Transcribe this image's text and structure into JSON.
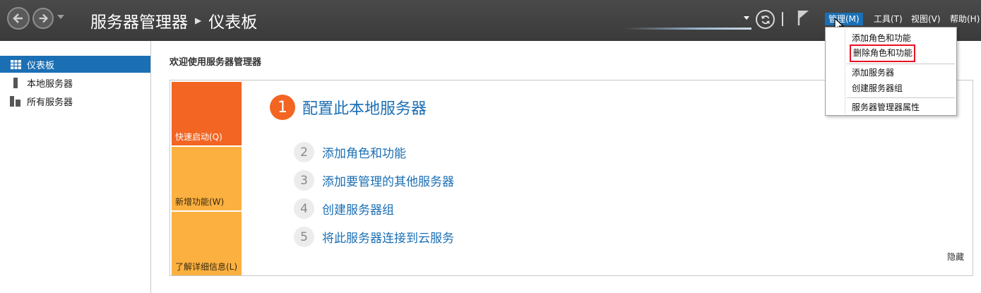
{
  "header": {
    "breadcrumb_root": "服务器管理器",
    "breadcrumb_current": "仪表板",
    "menus": [
      {
        "label": "管理(M)",
        "active": true
      },
      {
        "label": "工具(T)",
        "active": false
      },
      {
        "label": "视图(V)",
        "active": false
      },
      {
        "label": "帮助(H)",
        "active": false
      }
    ]
  },
  "sidebar": {
    "items": [
      {
        "label": "仪表板",
        "icon": "dashboard-icon",
        "selected": true
      },
      {
        "label": "本地服务器",
        "icon": "server-icon",
        "selected": false
      },
      {
        "label": "所有服务器",
        "icon": "servers-icon",
        "selected": false
      }
    ]
  },
  "main": {
    "welcome": "欢迎使用服务器管理器",
    "tiles": [
      "快速启动(Q)",
      "新增功能(W)",
      "了解详细信息(L)"
    ],
    "steps": [
      {
        "num": "1",
        "label": "配置此本地服务器"
      },
      {
        "num": "2",
        "label": "添加角色和功能"
      },
      {
        "num": "3",
        "label": "添加要管理的其他服务器"
      },
      {
        "num": "4",
        "label": "创建服务器组"
      },
      {
        "num": "5",
        "label": "将此服务器连接到云服务"
      }
    ],
    "hide": "隐藏"
  },
  "dropdown": {
    "items": [
      "添加角色和功能",
      "删除角色和功能",
      "添加服务器",
      "创建服务器组",
      "服务器管理器属性"
    ]
  },
  "colors": {
    "accent": "#1b6fb4",
    "quickstart_tile": "#f26522",
    "secondary_tile": "#fbb040",
    "titlebar": "#3f3f3f",
    "highlight_box": "#e81123"
  }
}
